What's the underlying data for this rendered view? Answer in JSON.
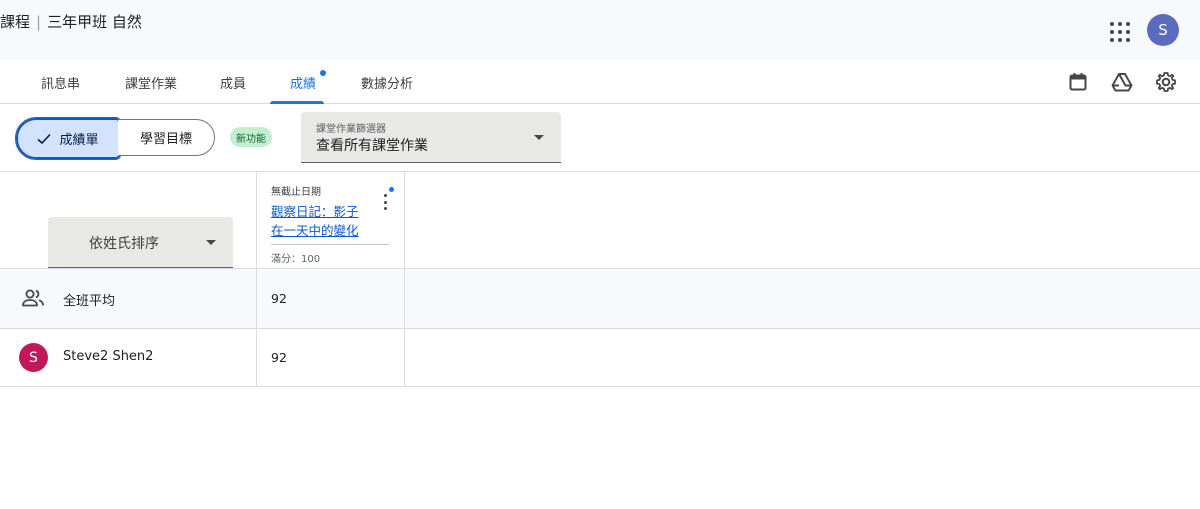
{
  "header": {
    "course_prefix": "課程",
    "course_name": "三年甲班 自然",
    "apps_icon": "apps-grid-icon",
    "avatar_letter": "S",
    "avatar_color": "#5c6bc0"
  },
  "tabs": [
    {
      "label": "訊息串",
      "active": false
    },
    {
      "label": "課堂作業",
      "active": false
    },
    {
      "label": "成員",
      "active": false
    },
    {
      "label": "成績",
      "active": true,
      "has_dot": true
    },
    {
      "label": "數據分析",
      "active": false
    }
  ],
  "toolbar_icons": [
    "calendar-icon",
    "google-drive-icon",
    "settings-gear-icon"
  ],
  "view_toggle": {
    "gradebook_label": "成績單",
    "gradebook_selected": true,
    "goals_label": "學習目標"
  },
  "new_badge": "新功能",
  "classwork_filter": {
    "label": "課堂作業篩選器",
    "value": "查看所有課堂作業"
  },
  "sort_select": {
    "value": "依姓氏排序"
  },
  "assignment": {
    "due": "無截止日期",
    "title": "觀察日記：影子在一天中的變化",
    "max_points": "滿分：100"
  },
  "rows": {
    "class_average": {
      "label": "全班平均",
      "score": "92"
    },
    "student": {
      "name": "Steve2 Shen2",
      "avatar_letter": "S",
      "avatar_color": "#c2185b",
      "score": "92"
    }
  },
  "colors": {
    "accent": "#1a73e8",
    "selected_chip": "#d3e3fd",
    "badge_bg": "#c4eed0"
  }
}
